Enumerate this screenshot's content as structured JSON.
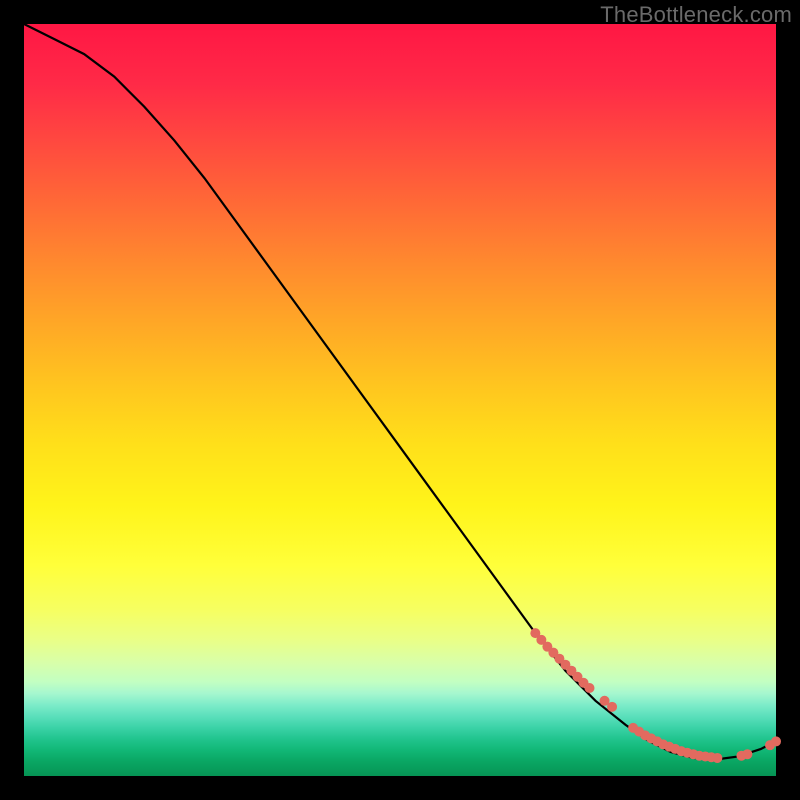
{
  "watermark": "TheBottleneck.com",
  "chart_data": {
    "type": "line",
    "title": "",
    "xlabel": "",
    "ylabel": "",
    "xlim": [
      0,
      100
    ],
    "ylim": [
      0,
      100
    ],
    "grid": false,
    "legend": false,
    "series": [
      {
        "name": "bottleneck-curve",
        "color": "#000000",
        "x": [
          0,
          4,
          8,
          12,
          16,
          20,
          24,
          28,
          32,
          36,
          40,
          44,
          48,
          52,
          56,
          60,
          64,
          68,
          72,
          76,
          80,
          83,
          86,
          89,
          92,
          95,
          98,
          100
        ],
        "y": [
          100,
          98,
          96,
          93,
          89,
          84.5,
          79.5,
          74,
          68.5,
          63,
          57.5,
          52,
          46.5,
          41,
          35.5,
          30,
          24.5,
          19,
          14,
          10,
          6.8,
          4.7,
          3.2,
          2.4,
          2.2,
          2.6,
          3.6,
          4.6
        ]
      }
    ],
    "markers": [
      {
        "name": "highlight-points",
        "color": "#e26a5f",
        "radius": 5,
        "points": [
          {
            "x": 68.0,
            "y": 19.0
          },
          {
            "x": 68.8,
            "y": 18.1
          },
          {
            "x": 69.6,
            "y": 17.2
          },
          {
            "x": 70.4,
            "y": 16.4
          },
          {
            "x": 71.2,
            "y": 15.6
          },
          {
            "x": 72.0,
            "y": 14.8
          },
          {
            "x": 72.8,
            "y": 14.0
          },
          {
            "x": 73.6,
            "y": 13.2
          },
          {
            "x": 74.4,
            "y": 12.4
          },
          {
            "x": 75.2,
            "y": 11.7
          },
          {
            "x": 77.2,
            "y": 10.0
          },
          {
            "x": 78.2,
            "y": 9.2
          },
          {
            "x": 81.0,
            "y": 6.4
          },
          {
            "x": 81.8,
            "y": 5.9
          },
          {
            "x": 82.6,
            "y": 5.4
          },
          {
            "x": 83.4,
            "y": 5.0
          },
          {
            "x": 84.2,
            "y": 4.6
          },
          {
            "x": 85.0,
            "y": 4.2
          },
          {
            "x": 85.8,
            "y": 3.9
          },
          {
            "x": 86.6,
            "y": 3.6
          },
          {
            "x": 87.4,
            "y": 3.3
          },
          {
            "x": 88.2,
            "y": 3.1
          },
          {
            "x": 89.0,
            "y": 2.9
          },
          {
            "x": 89.8,
            "y": 2.7
          },
          {
            "x": 90.6,
            "y": 2.6
          },
          {
            "x": 91.4,
            "y": 2.5
          },
          {
            "x": 92.2,
            "y": 2.4
          },
          {
            "x": 95.4,
            "y": 2.7
          },
          {
            "x": 96.2,
            "y": 2.9
          },
          {
            "x": 99.2,
            "y": 4.1
          },
          {
            "x": 100.0,
            "y": 4.6
          }
        ]
      }
    ]
  }
}
